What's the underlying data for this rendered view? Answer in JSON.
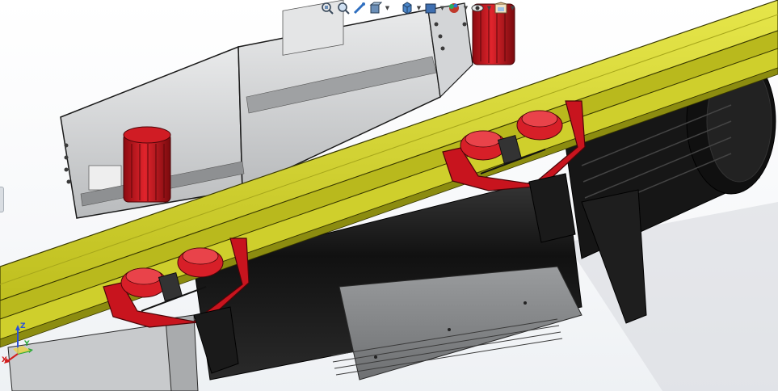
{
  "viewport": {
    "background_top": "#ffffff",
    "background_bottom": "#eef1f4"
  },
  "hud_toolbar": {
    "buttons": [
      {
        "id": "zoom-to-fit",
        "icon": "zoom-fit-icon"
      },
      {
        "id": "zoom-area",
        "icon": "zoom-area-icon"
      },
      {
        "id": "previous-view",
        "icon": "previous-view-icon"
      },
      {
        "id": "section-view",
        "icon": "section-view-icon"
      },
      {
        "id": "view-orientation",
        "icon": "view-cube-icon",
        "dropdown": true
      },
      {
        "id": "display-style",
        "icon": "display-style-icon",
        "dropdown": true
      },
      {
        "id": "hide-show-items",
        "icon": "eye-icon",
        "dropdown": true
      },
      {
        "id": "edit-appearance",
        "icon": "appearance-sphere-icon",
        "dropdown": true
      },
      {
        "id": "apply-scene",
        "icon": "scene-icon",
        "dropdown": true
      }
    ]
  },
  "triad": {
    "x_label": "X",
    "y_label": "Y",
    "z_label": "Z",
    "x_color": "#d21e1e",
    "y_color": "#2aa838",
    "z_color": "#2a52d6"
  },
  "model": {
    "beam_color": "#d6d62a",
    "beam_shadow": "#8f8f12",
    "trolley_red": "#c8141e",
    "motor_black": "#1c1c1c",
    "housing_gray": "#c9cbcd"
  }
}
